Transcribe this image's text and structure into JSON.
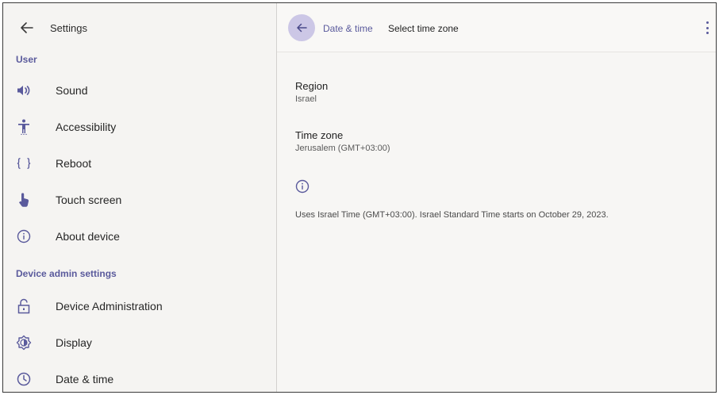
{
  "left_pane": {
    "title": "Settings",
    "sections": [
      {
        "label": "User",
        "items": [
          {
            "label": "Sound",
            "icon": "volume-icon"
          },
          {
            "label": "Accessibility",
            "icon": "accessibility-icon"
          },
          {
            "label": "Reboot",
            "icon": "braces-icon"
          },
          {
            "label": "Touch screen",
            "icon": "touch-icon"
          },
          {
            "label": "About device",
            "icon": "info-icon"
          }
        ]
      },
      {
        "label": "Device admin settings",
        "items": [
          {
            "label": "Device Administration",
            "icon": "unlock-icon"
          },
          {
            "label": "Display",
            "icon": "brightness-icon"
          },
          {
            "label": "Date & time",
            "icon": "clock-icon"
          }
        ]
      }
    ]
  },
  "right_pane": {
    "breadcrumb_parent": "Date & time",
    "breadcrumb_current": "Select time zone",
    "region": {
      "title": "Region",
      "value": "Israel"
    },
    "time_zone": {
      "title": "Time zone",
      "value": "Jerusalem (GMT+03:00)"
    },
    "info_text": "Uses Israel Time (GMT+03:00). Israel Standard Time starts on October 29, 2023."
  },
  "colors": {
    "accent": "#5a5a9c",
    "back_button_bg": "#ccc7e6",
    "pane_bg": "#f5f4f2"
  }
}
